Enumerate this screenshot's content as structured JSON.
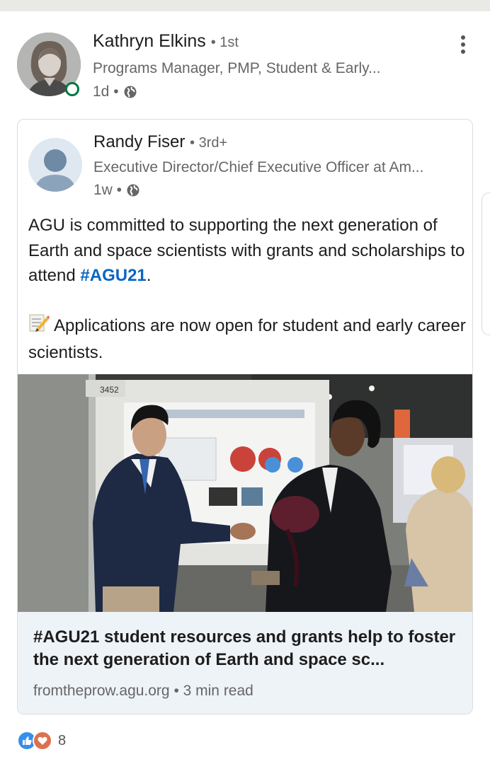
{
  "author": {
    "name": "Kathryn Elkins",
    "connection": "• 1st",
    "headline": "Programs Manager, PMP, Student & Early...",
    "time": "1d •",
    "visibility_icon": "globe-icon",
    "online": true
  },
  "shared_post": {
    "author_name": "Randy Fiser",
    "connection": "• 3rd+",
    "headline": "Executive Director/Chief Executive Officer at Am...",
    "time": "1w •",
    "visibility_icon": "globe-icon",
    "text_part1": "AGU is committed to supporting the next generation of Earth and space scientists with grants and scholarships to attend ",
    "hashtag": "#AGU21",
    "text_part1_end": ".",
    "text_part2": "Applications are now open for student and early career scientists.",
    "emoji_icon": "memo-pencil-icon"
  },
  "link_preview": {
    "title": "#AGU21 student resources and grants help to foster the next generation of Earth and space sc...",
    "source": "fromtheprow.agu.org • 3 min read",
    "image_caption_number": "3452"
  },
  "reactions": {
    "count": "8",
    "icons": [
      "like-icon",
      "love-icon"
    ]
  },
  "colors": {
    "link_blue": "#0a66c2",
    "online_green": "#057642",
    "like_blue": "#378fe9",
    "love_red": "#df704d",
    "preview_bg": "#eef3f8"
  }
}
